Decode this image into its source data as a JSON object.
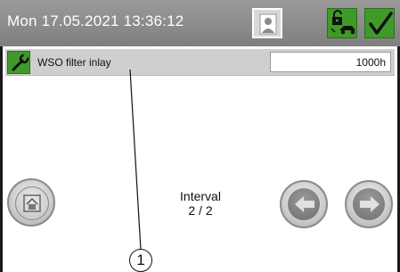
{
  "header": {
    "datetime": "Mon 17.05.2021  13:36:12",
    "icons": [
      "user-icon",
      "unlock-vehicle-icon",
      "checkmark-icon"
    ]
  },
  "maintenance_row": {
    "icon": "wrench-icon",
    "label": "WSO filter inlay",
    "value": "1000h"
  },
  "interval": {
    "label": "Interval",
    "value": "2 / 2"
  },
  "nav": {
    "icons": [
      "home-icon",
      "arrow-left-icon",
      "arrow-right-icon"
    ]
  },
  "callout": {
    "number": "1"
  },
  "colors": {
    "header_gray": "#8c8c8c",
    "button_green": "#3f9a2a",
    "row_gray": "#cfcfcf"
  }
}
